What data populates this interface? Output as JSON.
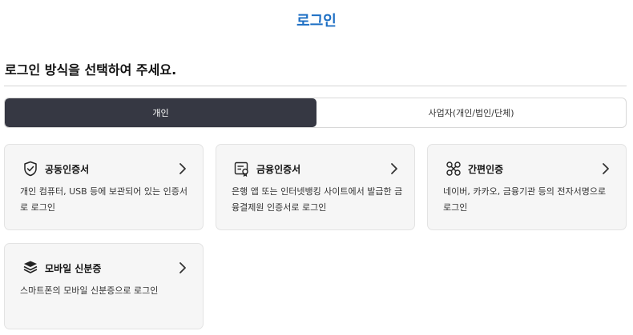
{
  "header": {
    "title": "로그인"
  },
  "section": {
    "heading": "로그인 방식을 선택하여 주세요."
  },
  "tabs": [
    {
      "label": "개인",
      "active": true
    },
    {
      "label": "사업자(개인/법인/단체)",
      "active": false
    }
  ],
  "cards": [
    {
      "title": "공동인증서",
      "desc": "개인 컴퓨터, USB 등에 보관되어 있는 인증서로 로그인",
      "icon": "shield-icon"
    },
    {
      "title": "금융인증서",
      "desc": "은행 앱 또는 인터넷뱅킹 사이트에서 발급한 금융결제원 인증서로 로그인",
      "icon": "certificate-icon"
    },
    {
      "title": "간편인증",
      "desc": "네이버, 카카오, 금융기관 등의 전자서명으로 로그인",
      "icon": "network-icon"
    },
    {
      "title": "모바일 신분증",
      "desc": "스마트폰의 모바일 신분증으로 로그인",
      "icon": "id-card-stack-icon"
    }
  ],
  "colors": {
    "accent": "#1d6fc4",
    "active_tab": "#363843",
    "card_bg": "#f6f6f6"
  }
}
